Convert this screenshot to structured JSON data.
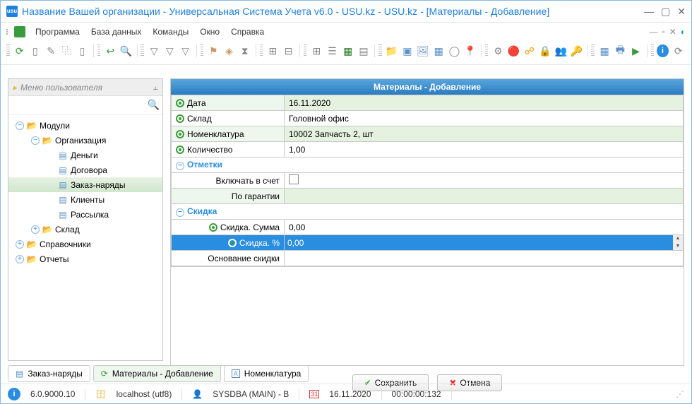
{
  "window": {
    "title": "Название Вашей организации - Универсальная Система Учета v6.0 - USU.kz - USU.kz - [Материалы - Добавление]"
  },
  "menu": {
    "program": "Программа",
    "database": "База данных",
    "commands": "Команды",
    "window": "Окно",
    "help": "Справка"
  },
  "sidebar": {
    "header": "Меню пользователя",
    "tree": [
      {
        "label": "Модули",
        "type": "folder",
        "indent": 0,
        "exp": "−"
      },
      {
        "label": "Организация",
        "type": "folder",
        "indent": 1,
        "exp": "−"
      },
      {
        "label": "Деньги",
        "type": "leaf",
        "indent": 2
      },
      {
        "label": "Договора",
        "type": "leaf",
        "indent": 2
      },
      {
        "label": "Заказ-наряды",
        "type": "leaf",
        "indent": 2,
        "selected": true
      },
      {
        "label": "Клиенты",
        "type": "leaf",
        "indent": 2
      },
      {
        "label": "Рассылка",
        "type": "leaf",
        "indent": 2
      },
      {
        "label": "Склад",
        "type": "folder",
        "indent": 1,
        "exp": "+"
      },
      {
        "label": "Справочники",
        "type": "folder",
        "indent": 0,
        "exp": "+"
      },
      {
        "label": "Отчеты",
        "type": "folder",
        "indent": 0,
        "exp": "+"
      }
    ]
  },
  "form": {
    "title": "Материалы - Добавление",
    "fields": {
      "date_label": "Дата",
      "date_value": "16.11.2020",
      "warehouse_label": "Склад",
      "warehouse_value": "Головной офис",
      "nomenclature_label": "Номенклатура",
      "nomenclature_value": "10002 Запчасть 2, шт",
      "quantity_label": "Количество",
      "quantity_value": "1,00"
    },
    "section_marks": "Отметки",
    "marks": {
      "include_bill_label": "Включать в счет",
      "warranty_label": "По гарантии"
    },
    "section_discount": "Скидка",
    "discount": {
      "sum_label": "Скидка. Сумма",
      "sum_value": "0,00",
      "percent_label": "Скидка. %",
      "percent_value": "0,00",
      "basis_label": "Основание скидки"
    }
  },
  "buttons": {
    "save": "Сохранить",
    "cancel": "Отмена"
  },
  "tabs": {
    "orders": "Заказ-наряды",
    "materials_add": "Материалы - Добавление",
    "nomenclature": "Номенклатура"
  },
  "status": {
    "version": "6.0.9000.10",
    "host": "localhost (utf8)",
    "user": "SYSDBA (MAIN) - B",
    "date": "16.11.2020",
    "time": "00:00:00:132"
  }
}
